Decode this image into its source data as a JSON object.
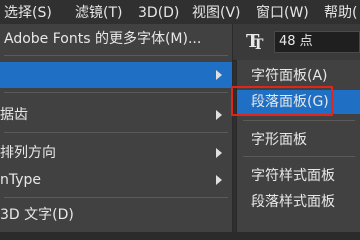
{
  "menubar": {
    "items": [
      {
        "label": "选择(S)"
      },
      {
        "label": "滤镜(T)"
      },
      {
        "label": "3D(D)"
      },
      {
        "label": "视图(V)"
      },
      {
        "label": "窗口(W)"
      },
      {
        "label": "帮助("
      }
    ]
  },
  "toolbar": {
    "font_size_value": "48 点",
    "icon": "text-orientation-icon"
  },
  "main_menu": {
    "items": [
      {
        "label": "Adobe Fonts 的更多字体(M)...",
        "has_submenu": false
      },
      {
        "label": "",
        "has_submenu": true
      },
      {
        "label": "据齿",
        "has_submenu": true
      },
      {
        "label": "排列方向",
        "has_submenu": true
      },
      {
        "label": "nType",
        "has_submenu": true
      },
      {
        "label": "3D 文字(D)",
        "has_submenu": false
      }
    ]
  },
  "submenu": {
    "items": [
      {
        "label": "字符面板(A)"
      },
      {
        "label": "段落面板(G)"
      },
      {
        "label": "字形面板"
      },
      {
        "label": "字符样式面板"
      },
      {
        "label": "段落样式面板"
      }
    ]
  },
  "colors": {
    "highlight": "#1f6fc4",
    "annotation_box": "#e0261a",
    "menu_bg": "#414141"
  }
}
